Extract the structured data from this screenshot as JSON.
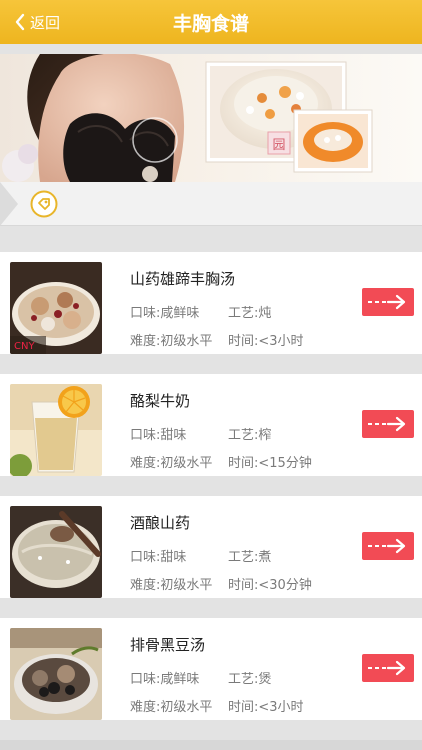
{
  "header": {
    "back_label": "返回",
    "title": "丰胸食谱"
  },
  "banner": {
    "stamp_text": "园"
  },
  "recipes": [
    {
      "name": "山药雄蹄丰胸汤",
      "taste": "口味:咸鲜味",
      "craft": "工艺:炖",
      "difficulty": "难度:初级水平",
      "time": "时间:<3小时",
      "thumb_caption": "CNY"
    },
    {
      "name": "酪梨牛奶",
      "taste": "口味:甜味",
      "craft": "工艺:榨",
      "difficulty": "难度:初级水平",
      "time": "时间:<15分钟"
    },
    {
      "name": "酒酿山药",
      "taste": "口味:甜味",
      "craft": "工艺:煮",
      "difficulty": "难度:初级水平",
      "time": "时间:<30分钟"
    },
    {
      "name": "排骨黑豆汤",
      "taste": "口味:咸鲜味",
      "craft": "工艺:煲",
      "difficulty": "难度:初级水平",
      "time": "时间:<3小时"
    }
  ],
  "colors": {
    "header": "#f2bc2a",
    "go_button": "#f24b55",
    "tag_icon": "#e8b52a"
  }
}
